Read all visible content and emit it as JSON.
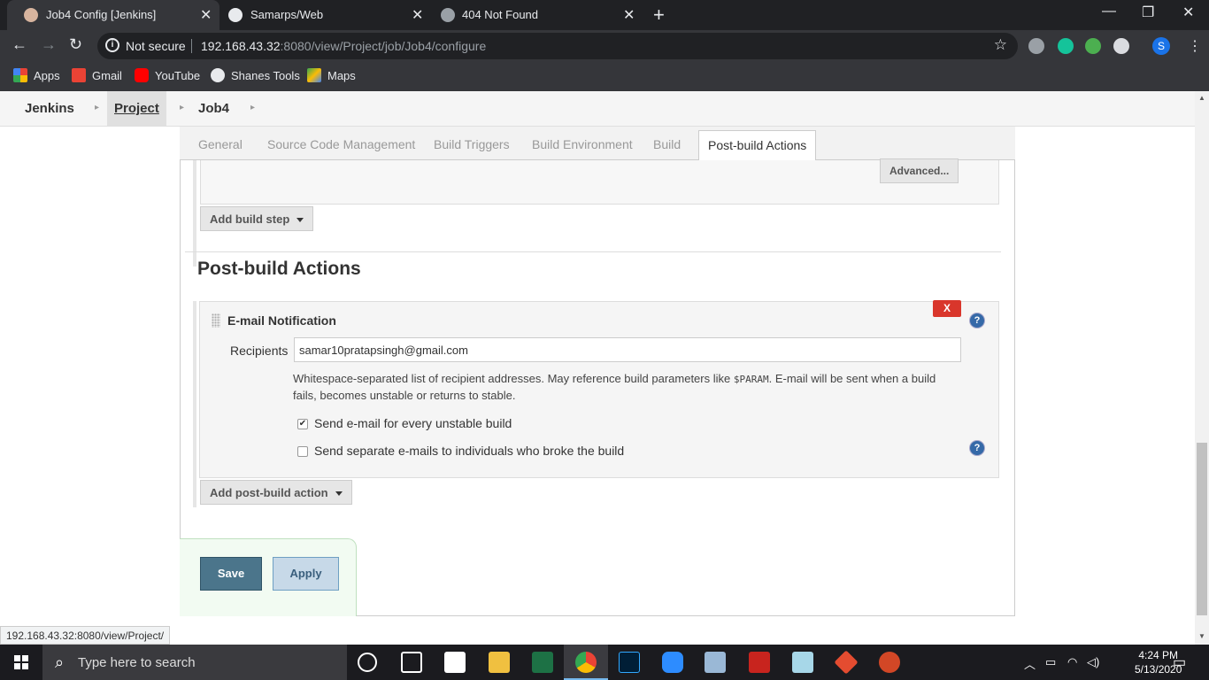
{
  "browser": {
    "tabs": [
      {
        "title": "Job4 Config [Jenkins]",
        "active": true
      },
      {
        "title": "Samarps/Web",
        "active": false
      },
      {
        "title": "404 Not Found",
        "active": false
      }
    ],
    "security_label": "Not secure",
    "url_host": "192.168.43.32",
    "url_rest": ":8080/view/Project/job/Job4/configure",
    "bookmarks": [
      "Apps",
      "Gmail",
      "YouTube",
      "Shanes Tools",
      "Maps"
    ],
    "profile_initial": "S",
    "status_url": "192.168.43.32:8080/view/Project/"
  },
  "jenkins": {
    "breadcrumbs": [
      "Jenkins",
      "Project",
      "Job4"
    ],
    "config_tabs": [
      "General",
      "Source Code Management",
      "Build Triggers",
      "Build Environment",
      "Build",
      "Post-build Actions"
    ],
    "active_tab": "Post-build Actions",
    "advanced_label": "Advanced...",
    "add_build_step_label": "Add build step",
    "section_title": "Post-build Actions",
    "email": {
      "title": "E-mail Notification",
      "delete_label": "X",
      "recipients_label": "Recipients",
      "recipients_value": "samar10pratapsingh@gmail.com",
      "desc_before": "Whitespace-separated list of recipient addresses. May reference build parameters like ",
      "desc_code": "$PARAM",
      "desc_after": ". E-mail will be sent when a build fails, becomes unstable or returns to stable.",
      "checkbox1_label": "Send e-mail for every unstable build",
      "checkbox1_checked": true,
      "checkbox2_label": "Send separate e-mails to individuals who broke the build",
      "checkbox2_checked": false
    },
    "add_post_build_label": "Add post-build action",
    "save_label": "Save",
    "apply_label": "Apply",
    "help_glyph": "?"
  },
  "taskbar": {
    "search_placeholder": "Type here to search",
    "time": "4:24 PM",
    "date": "5/13/2020"
  }
}
